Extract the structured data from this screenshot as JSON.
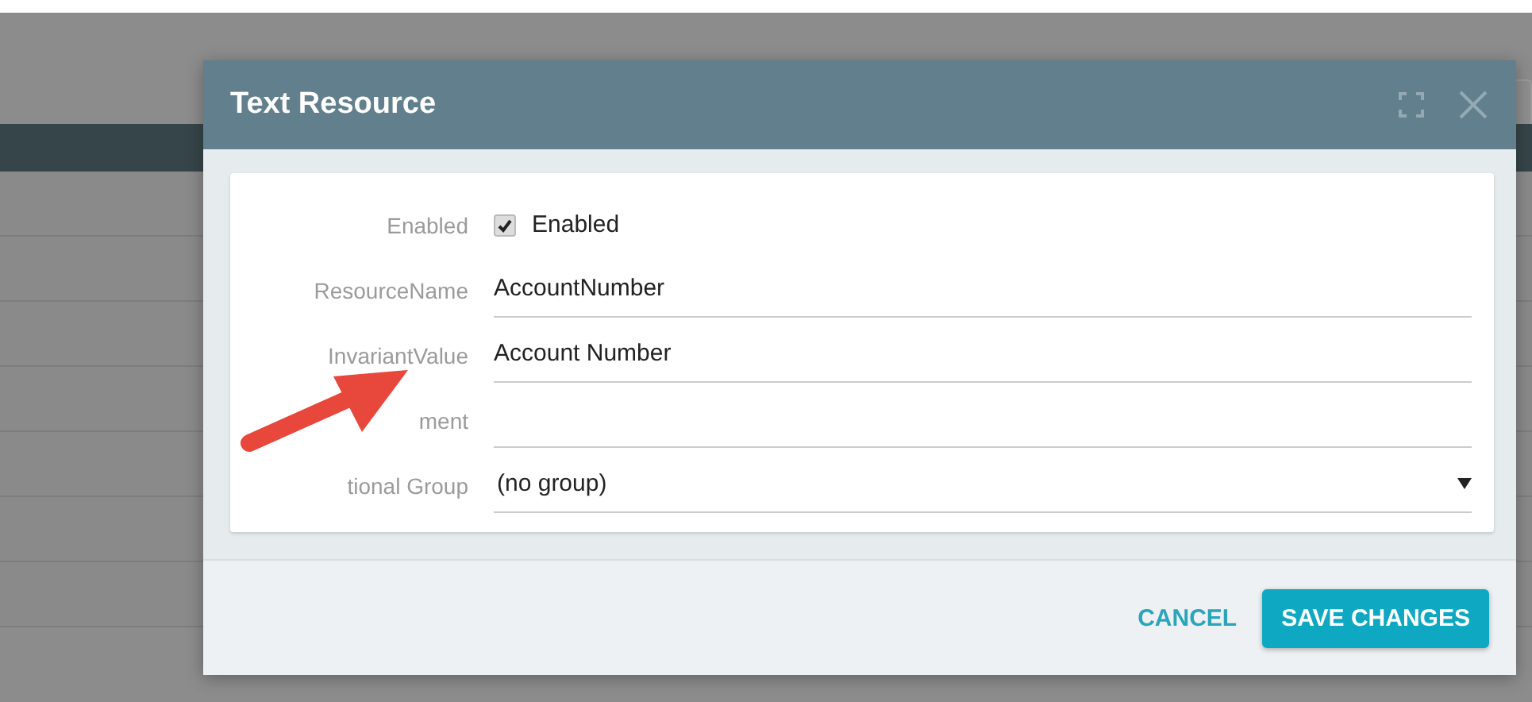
{
  "dialog": {
    "title": "Text Resource",
    "fields": [
      {
        "kind": "checkbox",
        "label": "Enabled",
        "checked": true,
        "text": "Enabled"
      },
      {
        "kind": "text",
        "label": "ResourceName",
        "value": "AccountNumber"
      },
      {
        "kind": "text",
        "label": "InvariantValue",
        "value": "Account Number"
      },
      {
        "kind": "text",
        "label": "ment"
      },
      {
        "kind": "select",
        "label": "tional Group",
        "value": "(no group)"
      }
    ],
    "buttons": [
      {
        "kind": "flat",
        "label": "CANCEL"
      },
      {
        "kind": "primary",
        "label": "SAVE CHANGES"
      }
    ]
  }
}
